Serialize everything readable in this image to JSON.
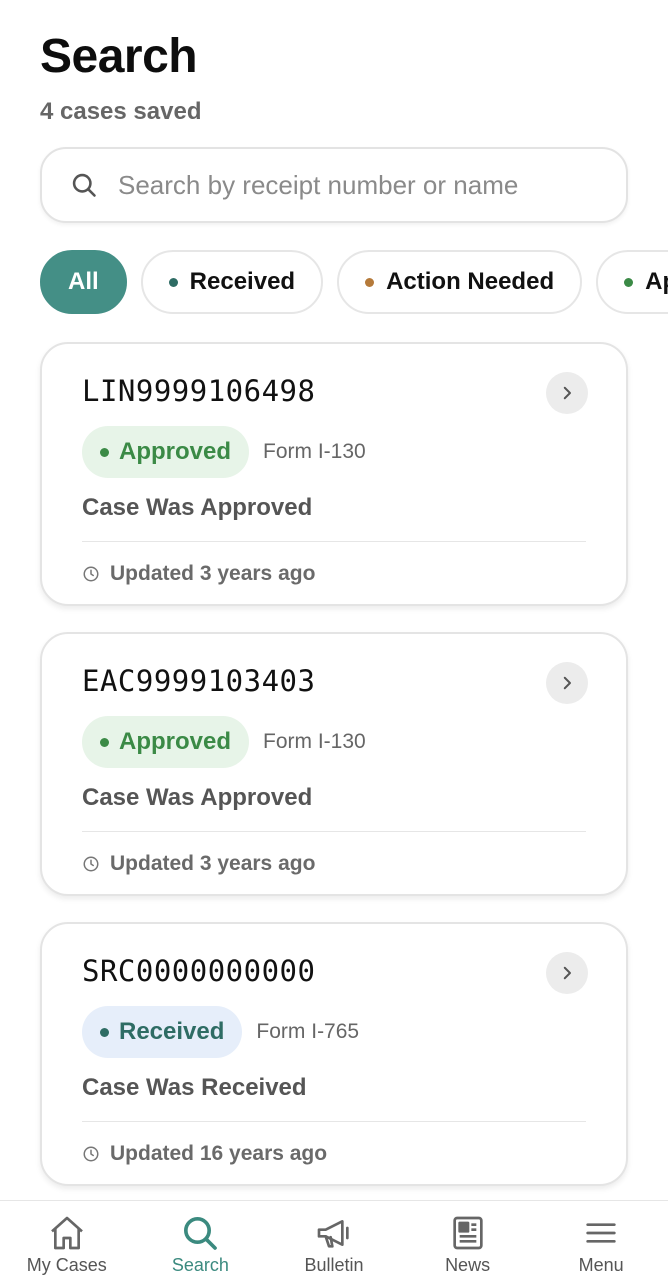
{
  "header": {
    "title": "Search",
    "subtitle": "4 cases saved"
  },
  "search": {
    "placeholder": "Search by receipt number or name",
    "value": ""
  },
  "filters": [
    {
      "label": "All",
      "active": true,
      "dot_color": null
    },
    {
      "label": "Received",
      "active": false,
      "dot_color": "#2e6c64"
    },
    {
      "label": "Action Needed",
      "active": false,
      "dot_color": "#b57a3a"
    },
    {
      "label": "App",
      "active": false,
      "dot_color": "#3b8a46"
    }
  ],
  "cases": [
    {
      "receipt": "LIN9999106498",
      "status": "Approved",
      "status_kind": "approved",
      "form": "Form I-130",
      "description": "Case Was Approved",
      "updated": "Updated 3 years ago"
    },
    {
      "receipt": "EAC9999103403",
      "status": "Approved",
      "status_kind": "approved",
      "form": "Form I-130",
      "description": "Case Was Approved",
      "updated": "Updated 3 years ago"
    },
    {
      "receipt": "SRC0000000000",
      "status": "Received",
      "status_kind": "received",
      "form": "Form I-765",
      "description": "Case Was Received",
      "updated": "Updated 16 years ago"
    }
  ],
  "nav": {
    "items": [
      {
        "label": "My Cases",
        "icon": "home-icon",
        "active": false
      },
      {
        "label": "Search",
        "icon": "search-icon",
        "active": true
      },
      {
        "label": "Bulletin",
        "icon": "megaphone-icon",
        "active": false
      },
      {
        "label": "News",
        "icon": "newspaper-icon",
        "active": false
      },
      {
        "label": "Menu",
        "icon": "hamburger-menu-icon",
        "active": false
      }
    ]
  },
  "colors": {
    "accent": "#448f86",
    "approved": "#3b8a46",
    "received": "#2e6c64",
    "action_needed": "#b57a3a"
  }
}
